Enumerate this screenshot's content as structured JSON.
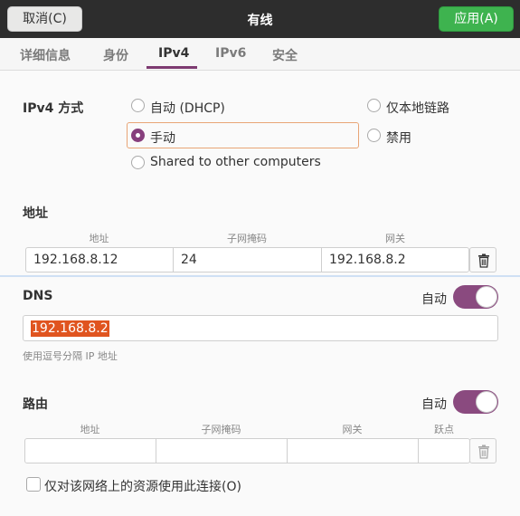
{
  "header": {
    "cancel_label": "取消(C)",
    "title": "有线",
    "apply_label": "应用(A)"
  },
  "tabs": [
    {
      "label": "详细信息",
      "active": false
    },
    {
      "label": "身份",
      "active": false
    },
    {
      "label": "IPv4",
      "active": true
    },
    {
      "label": "IPv6",
      "active": false
    },
    {
      "label": "安全",
      "active": false
    }
  ],
  "ipv4_method": {
    "label": "IPv4 方式",
    "options": [
      {
        "label": "自动 (DHCP)",
        "checked": false
      },
      {
        "label": "仅本地链路",
        "checked": false
      },
      {
        "label": "手动",
        "checked": true
      },
      {
        "label": "禁用",
        "checked": false
      },
      {
        "label": "Shared to other computers",
        "checked": false
      }
    ]
  },
  "addresses": {
    "label": "地址",
    "headers": [
      "地址",
      "子网掩码",
      "网关"
    ],
    "rows": [
      {
        "address": "192.168.8.12",
        "netmask": "24",
        "gateway": "192.168.8.2"
      }
    ]
  },
  "dns": {
    "label": "DNS",
    "auto_label": "自动",
    "auto_enabled": true,
    "value": "192.168.8.2",
    "hint": "使用逗号分隔 IP 地址"
  },
  "routes": {
    "label": "路由",
    "auto_label": "自动",
    "auto_enabled": true,
    "headers": [
      "地址",
      "子网掩码",
      "网关",
      "跃点"
    ],
    "rows": [
      {
        "address": "",
        "netmask": "",
        "gateway": "",
        "metric": ""
      }
    ],
    "only_local_label": "仅对该网络上的资源使用此连接(O)",
    "only_local_checked": false
  },
  "colors": {
    "accent": "#873f7d",
    "apply_green": "#3eb34f",
    "header_bg": "#2d2d2d",
    "selection": "#e0541f"
  }
}
